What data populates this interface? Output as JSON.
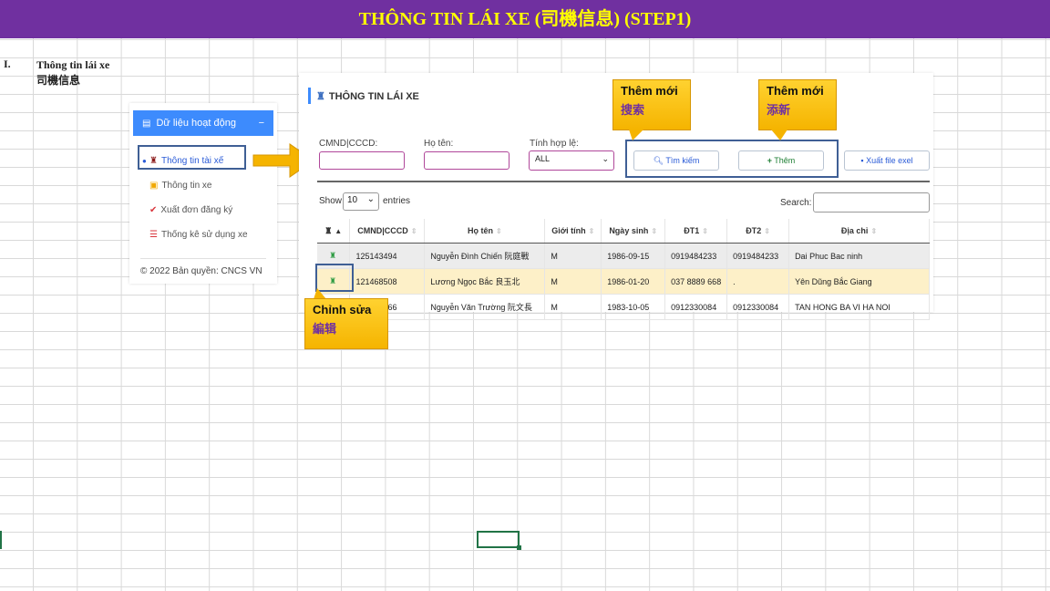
{
  "banner": {
    "title": "THÔNG TIN LÁI XE (司機信息) (STEP1)"
  },
  "section": {
    "number": "I.",
    "title_vi": "Thông tin lái xe",
    "title_cn": "司機信息"
  },
  "sidebar": {
    "header": "Dữ liệu hoạt động",
    "collapse_icon": "−",
    "items": [
      {
        "label": "Thông tin tài xế",
        "icon": "driver-icon",
        "active": true
      },
      {
        "label": "Thông tin xe",
        "icon": "bus-icon",
        "active": false
      },
      {
        "label": "Xuất đơn đăng ký",
        "icon": "check-icon",
        "active": false
      },
      {
        "label": "Thống kê sử dụng xe",
        "icon": "list-icon",
        "active": false
      }
    ],
    "footer": "© 2022 Bản quyền: CNCS VN"
  },
  "panel": {
    "title": "THÔNG TIN LÁI XE",
    "filters": {
      "id_label": "CMND|CCCD:",
      "name_label": "Họ tên:",
      "valid_label": "Tính hợp lệ:",
      "valid_value": "ALL"
    },
    "buttons": {
      "search": "Tìm kiếm",
      "add": "Thêm",
      "export": "Xuất file exel"
    },
    "show_label": "Show",
    "entries_value": "10",
    "entries_label": "entries",
    "search_label": "Search:"
  },
  "table": {
    "columns": [
      "",
      "CMND|CCCD",
      "Họ tên",
      "Giới tính",
      "Ngày sinh",
      "ĐT1",
      "ĐT2",
      "Địa chỉ"
    ],
    "rows": [
      [
        "125143494",
        "Nguyễn Đình Chiến 阮庭戰",
        "M",
        "1986-09-15",
        "0919484233",
        "0919484233",
        "Dai Phuc Bac ninh"
      ],
      [
        "121468508",
        "Lương Ngọc Bắc 良玉北",
        "M",
        "1986-01-20",
        "037 8889 668",
        ".",
        "Yên Dũng Bắc Giang"
      ],
      [
        "141784966",
        "Nguyễn Văn Trường 阮文長",
        "M",
        "1983-10-05",
        "0912330084",
        "0912330084",
        "TAN HONG BA VI HA NOI"
      ]
    ]
  },
  "callouts": {
    "search": {
      "vi": "Thêm mới",
      "cn": "搜索"
    },
    "add": {
      "vi": "Thêm mới",
      "cn": "添新"
    },
    "edit": {
      "vi": "Chỉnh sửa",
      "cn": "編辑"
    }
  },
  "colors": {
    "banner_bg": "#7030a0",
    "banner_text": "#ffff00",
    "accent": "#3d8bfd",
    "callout": "#f5b400",
    "highlight_border": "#3f5f95"
  }
}
